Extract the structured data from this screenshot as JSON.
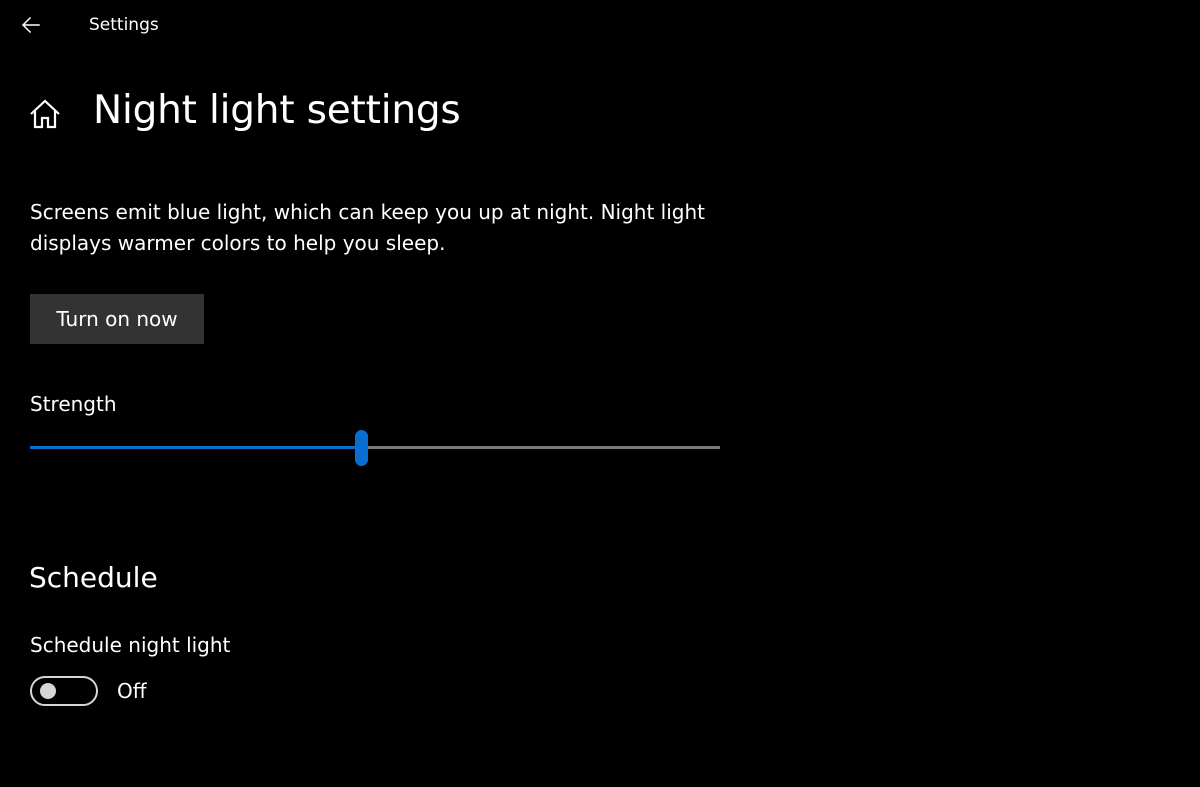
{
  "titlebar": {
    "back_icon": "back-arrow-icon",
    "title": "Settings"
  },
  "header": {
    "home_icon": "home-icon",
    "title": "Night light settings"
  },
  "description": "Screens emit blue light, which can keep you up at night. Night light displays warmer colors to help you sleep.",
  "turn_on_button": {
    "label": "Turn on now"
  },
  "strength": {
    "label": "Strength",
    "value_fraction": 0.48
  },
  "schedule": {
    "heading": "Schedule",
    "toggle_label": "Schedule night light",
    "toggle_state": "Off",
    "toggle_on": false
  },
  "colors": {
    "background": "#000000",
    "text": "#ffffff",
    "accent": "#0a6ed1",
    "button_background": "#333333",
    "slider_track": "#7a7a7a",
    "toggle_off": "#d6d6d6"
  }
}
